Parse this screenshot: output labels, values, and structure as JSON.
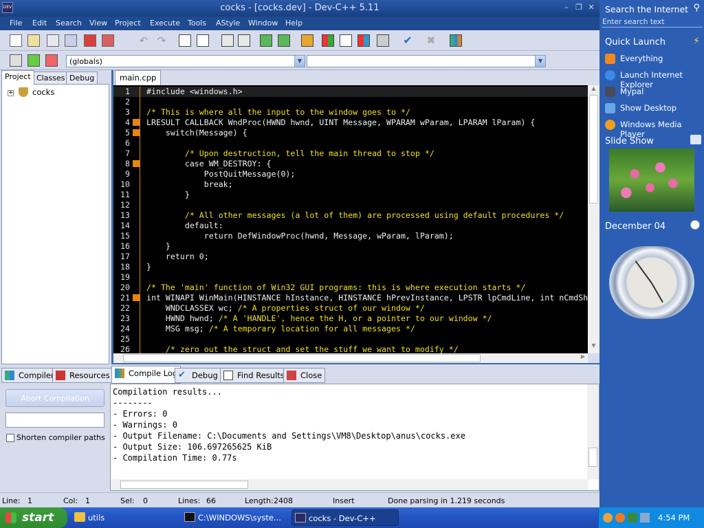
{
  "window": {
    "title": "cocks - [cocks.dev] - Dev-C++ 5.11",
    "minimize": "–",
    "restore": "❐",
    "close": "✕"
  },
  "menu": [
    "File",
    "Edit",
    "Search",
    "View",
    "Project",
    "Execute",
    "Tools",
    "AStyle",
    "Window",
    "Help"
  ],
  "toolbar2": {
    "scope_combo": "(globals)",
    "symbol_combo": ""
  },
  "left_tabs": [
    "Project",
    "Classes",
    "Debug"
  ],
  "project_tree": {
    "expand": "+",
    "root": "cocks"
  },
  "editor_tab": "main.cpp",
  "code_lines": [
    {
      "n": "1",
      "text": "#include <windows.h>",
      "type": "pre",
      "marker": false
    },
    {
      "n": "2",
      "text": "",
      "type": "code",
      "marker": false
    },
    {
      "n": "3",
      "text": "/* This is where all the input to the window goes to */",
      "type": "comment",
      "marker": false
    },
    {
      "n": "4",
      "text": "LRESULT CALLBACK WndProc(HWND hwnd, UINT Message, WPARAM wParam, LPARAM lParam) {",
      "type": "code",
      "marker": true
    },
    {
      "n": "5",
      "text": "    switch(Message) {",
      "type": "code",
      "marker": true
    },
    {
      "n": "6",
      "text": "",
      "type": "code",
      "marker": false
    },
    {
      "n": "7",
      "text": "        /* Upon destruction, tell the main thread to stop */",
      "type": "comment",
      "marker": false
    },
    {
      "n": "8",
      "text": "        case WM_DESTROY: {",
      "type": "code",
      "marker": true
    },
    {
      "n": "9",
      "text": "            PostQuitMessage(0);",
      "type": "code",
      "marker": false
    },
    {
      "n": "10",
      "text": "            break;",
      "type": "code",
      "marker": false
    },
    {
      "n": "11",
      "text": "        }",
      "type": "code",
      "marker": false
    },
    {
      "n": "12",
      "text": "",
      "type": "code",
      "marker": false
    },
    {
      "n": "13",
      "text": "        /* All other messages (a lot of them) are processed using default procedures */",
      "type": "comment",
      "marker": false
    },
    {
      "n": "14",
      "text": "        default:",
      "type": "code",
      "marker": false
    },
    {
      "n": "15",
      "text": "            return DefWindowProc(hwnd, Message, wParam, lParam);",
      "type": "code",
      "marker": false
    },
    {
      "n": "16",
      "text": "    }",
      "type": "code",
      "marker": false
    },
    {
      "n": "17",
      "text": "    return 0;",
      "type": "code",
      "marker": false
    },
    {
      "n": "18",
      "text": "}",
      "type": "code",
      "marker": false
    },
    {
      "n": "19",
      "text": "",
      "type": "code",
      "marker": false
    },
    {
      "n": "20",
      "text": "/* The 'main' function of Win32 GUI programs: this is where execution starts */",
      "type": "comment",
      "marker": false
    },
    {
      "n": "21",
      "text": "int WINAPI WinMain(HINSTANCE hInstance, HINSTANCE hPrevInstance, LPSTR lpCmdLine, int nCmdShow) {",
      "type": "code",
      "marker": true
    },
    {
      "n": "22",
      "text": "    WNDCLASSEX wc; /* A properties struct of our window */",
      "type": "mixed",
      "marker": false
    },
    {
      "n": "23",
      "text": "    HWND hwnd; /* A 'HANDLE', hence the H, or a pointer to our window */",
      "type": "mixed",
      "marker": false
    },
    {
      "n": "24",
      "text": "    MSG msg; /* A temporary location for all messages */",
      "type": "mixed",
      "marker": false
    },
    {
      "n": "25",
      "text": "",
      "type": "code",
      "marker": false
    },
    {
      "n": "26",
      "text": "    /* zero out the struct and set the stuff we want to modify */",
      "type": "comment",
      "marker": false
    }
  ],
  "bottom_tabs": [
    "Compiler",
    "Resources",
    "Compile Log",
    "Debug",
    "Find Results",
    "Close"
  ],
  "compile_panel": {
    "abort_label": "Abort Compilation",
    "progress_value": "",
    "shorten_label": "Shorten compiler paths",
    "shorten_checked": false
  },
  "compile_log": [
    "Compilation results...",
    "--------",
    "- Errors: 0",
    "- Warnings: 0",
    "- Output Filename: C:\\Documents and Settings\\VM8\\Desktop\\anus\\cocks.exe",
    "- Output Size: 106.697265625 KiB",
    "- Compilation Time: 0.77s"
  ],
  "status": {
    "line_label": "Line:",
    "line": "1",
    "col_label": "Col:",
    "col": "1",
    "sel_label": "Sel:",
    "sel": "0",
    "lines_label": "Lines:",
    "lines": "66",
    "length_label": "Length:",
    "length": "2408",
    "mode": "Insert",
    "message": "Done parsing in 1.219 seconds"
  },
  "sidebar": {
    "search_title": "Search the Internet",
    "search_placeholder": "Enter search text",
    "quick_launch": "Quick Launch",
    "items": [
      "Everything",
      "Launch Internet Explorer",
      "Mypal",
      "Show Desktop",
      "Windows Media Player"
    ],
    "slide_show": "Slide Show",
    "date": "December 04"
  },
  "taskbar": {
    "start": "start",
    "tasks": [
      "utils",
      "C:\\WINDOWS\\syste...",
      "cocks - Dev-C++"
    ],
    "clock": "4:54 PM"
  },
  "colors": {
    "editor_bg": "#000000",
    "comment": "#f0e020",
    "marker": "#e8860c",
    "titlebar": "#1f4a94",
    "sidebar": "#2c5fb4"
  }
}
